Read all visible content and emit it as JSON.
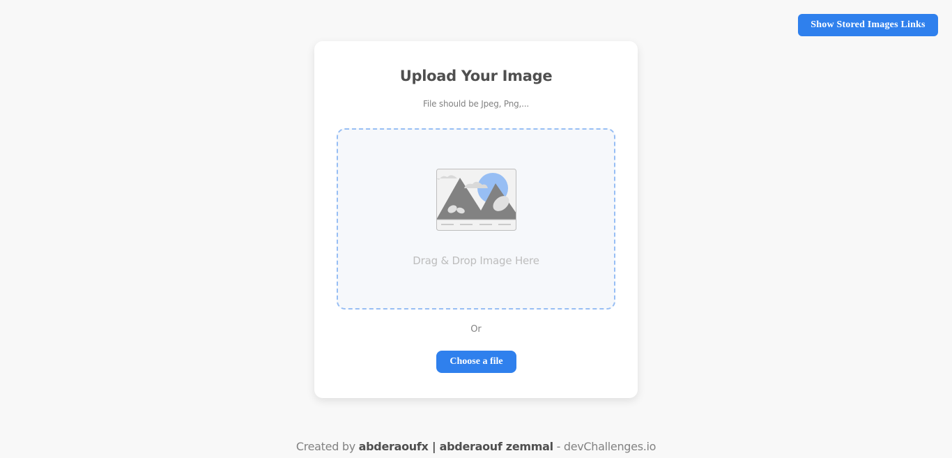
{
  "header": {
    "stored_links_button": "Show Stored Images Links"
  },
  "upload_card": {
    "title": "Upload Your Image",
    "subtitle": "File should be Jpeg, Png,...",
    "dropzone_text": "Drag & Drop Image Here",
    "or_text": "Or",
    "choose_button": "Choose a file",
    "illustration_icon": "image-placeholder-icon"
  },
  "footer": {
    "prefix": "Created by ",
    "author": "abderaoufx | abderaouf zemmal",
    "separator": " - ",
    "site": "devChallenges.io"
  },
  "colors": {
    "accent": "#2f80ed",
    "dropzone_border": "#97bef4",
    "dropzone_bg": "#f6f8fb",
    "page_bg": "#f8f8f8"
  }
}
